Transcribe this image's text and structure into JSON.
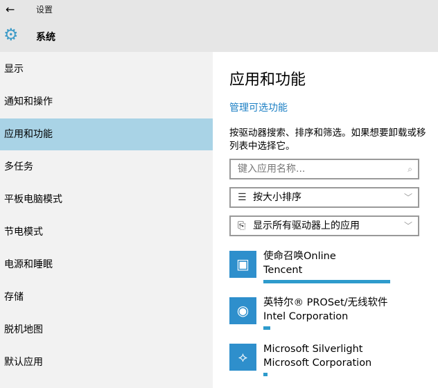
{
  "header": {
    "back_icon": "arrow-left-icon",
    "app_title": "设置",
    "section_icon": "gear-icon",
    "section_title": "系统"
  },
  "sidebar": {
    "items": [
      {
        "label": "显示",
        "selected": false
      },
      {
        "label": "通知和操作",
        "selected": false
      },
      {
        "label": "应用和功能",
        "selected": true
      },
      {
        "label": "多任务",
        "selected": false
      },
      {
        "label": "平板电脑模式",
        "selected": false
      },
      {
        "label": "节电模式",
        "selected": false
      },
      {
        "label": "电源和睡眠",
        "selected": false
      },
      {
        "label": "存储",
        "selected": false
      },
      {
        "label": "脱机地图",
        "selected": false
      },
      {
        "label": "默认应用",
        "selected": false
      }
    ]
  },
  "main": {
    "title": "应用和功能",
    "manage_link": "管理可选功能",
    "desc_line1": "按驱动器搜索、排序和筛选。如果想要卸载或移",
    "desc_line2": "列表中选择它。",
    "search": {
      "placeholder": "键入应用名称...",
      "icon": "search-icon"
    },
    "sort": {
      "value": "按大小排序",
      "icon": "sort-list-icon"
    },
    "filter": {
      "value": "显示所有驱动器上的应用",
      "icon": "drive-icon"
    },
    "apps": [
      {
        "name": "使命召唤Online",
        "publisher": "Tencent",
        "size_fraction": 1.0,
        "icon": "game-icon"
      },
      {
        "name": "英特尔® PROSet/无线软件",
        "publisher": "Intel Corporation",
        "size_fraction": 0.055,
        "icon": "wifi-icon"
      },
      {
        "name": "Microsoft Silverlight",
        "publisher": "Microsoft Corporation",
        "size_fraction": 0.035,
        "icon": "silverlight-icon"
      }
    ]
  },
  "colors": {
    "accent": "#2e9bcc",
    "selected": "#a9d3e6",
    "link": "#1b7fc4"
  }
}
